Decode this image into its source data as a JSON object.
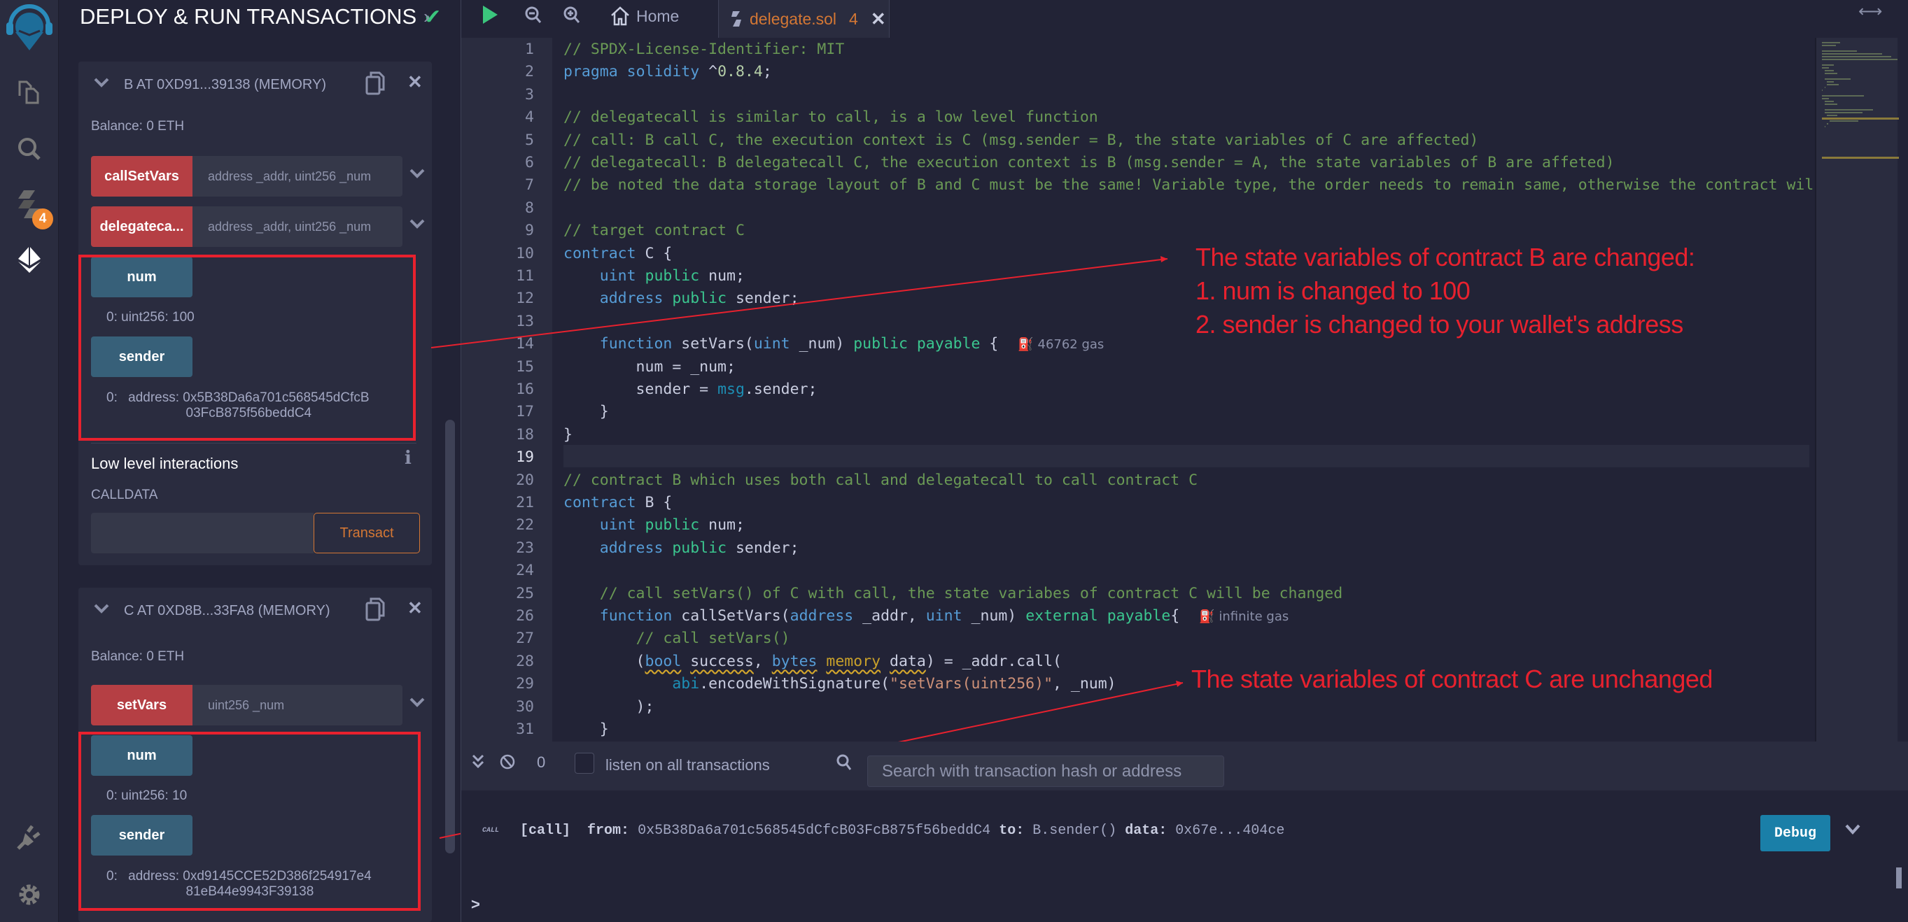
{
  "iconbar": {
    "items": [
      {
        "name": "remix-logo"
      },
      {
        "name": "file-explorer"
      },
      {
        "name": "search"
      },
      {
        "name": "solidity-compiler",
        "badge": "4"
      },
      {
        "name": "deploy-run"
      },
      {
        "name": "plugin-manager"
      },
      {
        "name": "settings"
      }
    ]
  },
  "panel": {
    "title": "DEPLOY & RUN TRANSACTIONS",
    "instances": [
      {
        "title": "B AT 0XD91...39138 (MEMORY)",
        "balance": "Balance: 0 ETH",
        "functions": [
          {
            "label": "callSetVars",
            "placeholder": "address _addr, uint256 _num"
          },
          {
            "label": "delegateca...",
            "placeholder": "address _addr, uint256 _num"
          }
        ],
        "getters": [
          {
            "label": "num",
            "result_index": "0:",
            "result": "uint256: 100"
          },
          {
            "label": "sender",
            "result_index": "0:",
            "result_prefix": "address:",
            "result_line1": "0x5B38Da6a701c568545dCfcB",
            "result_line2": "03FcB875f56beddC4"
          }
        ]
      },
      {
        "title": "C AT 0XD8B...33FA8 (MEMORY)",
        "balance": "Balance: 0 ETH",
        "functions": [
          {
            "label": "setVars",
            "placeholder": "uint256 _num"
          }
        ],
        "getters": [
          {
            "label": "num",
            "result_index": "0:",
            "result": "uint256: 10"
          },
          {
            "label": "sender",
            "result_index": "0:",
            "result_prefix": "address:",
            "result_line1": "0xd9145CCE52D386f254917e4",
            "result_line2": "81eB44e9943F39138"
          }
        ]
      }
    ],
    "low_level": {
      "title": "Low level interactions",
      "calldata_label": "CALLDATA",
      "calldata_value": "",
      "transact_label": "Transact"
    }
  },
  "editor": {
    "tabs": [
      {
        "label": "Home"
      },
      {
        "label": "delegate.sol",
        "problems": "4",
        "active": true
      }
    ],
    "active_line": 19,
    "lines": [
      "// SPDX-License-Identifier: MIT",
      "pragma solidity ^0.8.4;",
      "",
      "// delegatecall is similar to call, is a low level function",
      "// call: B call C, the execution context is C (msg.sender = B, the state variables of C are affected)",
      "// delegatecall: B delegatecall C, the execution context is B (msg.sender = A, the state variables of B are affeted)",
      "// be noted the data storage layout of B and C must be the same! Variable type, the order needs to remain same, otherwise the contract wil",
      "",
      "// target contract C",
      "contract C {",
      "    uint public num;",
      "    address public sender;",
      "",
      "    function setVars(uint _num) public payable {",
      "        num = _num;",
      "        sender = msg.sender;",
      "    }",
      "}",
      "",
      "// contract B which uses both call and delegatecall to call contract C",
      "contract B {",
      "    uint public num;",
      "    address public sender;",
      "",
      "    // call setVars() of C with call, the state variabes of contract C will be changed",
      "    function callSetVars(address _addr, uint _num) external payable{",
      "        // call setVars()",
      "        (bool success, bytes memory data) = _addr.call(",
      "            abi.encodeWithSignature(\"setVars(uint256)\", _num)",
      "        );",
      "    }"
    ],
    "gas_hints": {
      "14": "46762 gas",
      "26": "infinite gas"
    }
  },
  "annotations": {
    "contract_b": [
      "The state variables of contract B are changed:",
      "1. num is changed to 100",
      "2. sender is changed to your wallet's address"
    ],
    "contract_c": "The state variables of contract C are unchanged",
    "color": "#e8212e"
  },
  "terminal": {
    "pending_count": "0",
    "listen_label": "listen on all transactions",
    "listen_checked": false,
    "search_placeholder": "Search with transaction hash or address",
    "tx": {
      "badge": "CALL",
      "kind": "[call]",
      "from_label": "from:",
      "from": "0x5B38Da6a701c568545dCfcB03FcB875f56beddC4",
      "to_label": "to:",
      "to": "B.sender()",
      "data_label": "data:",
      "data": "0x67e...404ce"
    },
    "debug_label": "Debug",
    "prompt": ">"
  }
}
